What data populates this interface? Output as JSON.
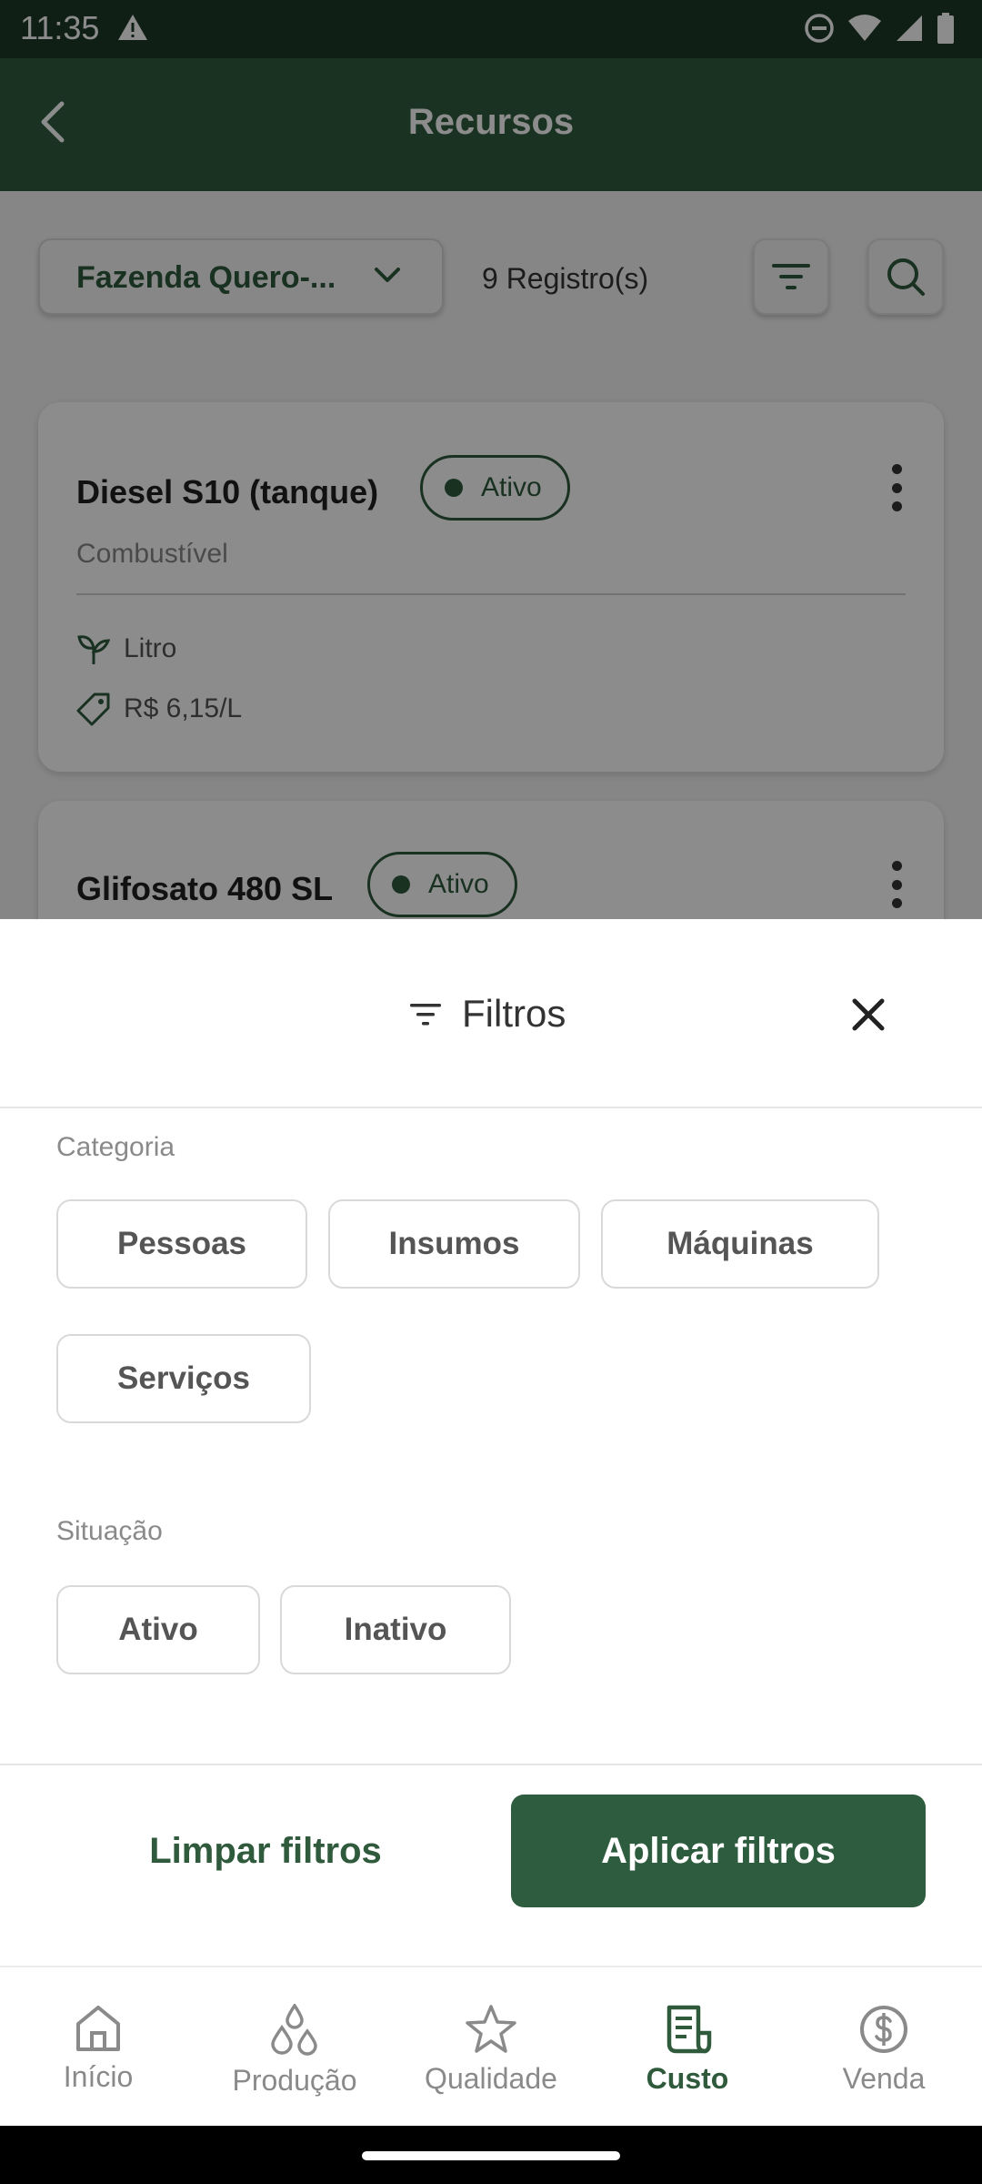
{
  "status_bar": {
    "time": "11:35"
  },
  "app_bar": {
    "title": "Recursos"
  },
  "toolbar": {
    "farm_selector": "Fazenda Quero-...",
    "record_count": "9 Registro(s)"
  },
  "cards": [
    {
      "title": "Diesel S10 (tanque)",
      "status": "Ativo",
      "category": "Combustível",
      "unit": "Litro",
      "price": "R$ 6,15/L"
    },
    {
      "title": "Glifosato 480 SL",
      "status": "Ativo"
    }
  ],
  "filters_sheet": {
    "title": "Filtros",
    "category_label": "Categoria",
    "categories": [
      "Pessoas",
      "Insumos",
      "Máquinas",
      "Serviços"
    ],
    "situation_label": "Situação",
    "situations": [
      "Ativo",
      "Inativo"
    ],
    "clear_label": "Limpar filtros",
    "apply_label": "Aplicar filtros"
  },
  "bottom_nav": [
    {
      "label": "Início",
      "icon": "home-icon"
    },
    {
      "label": "Produção",
      "icon": "drops-icon"
    },
    {
      "label": "Qualidade",
      "icon": "star-icon"
    },
    {
      "label": "Custo",
      "icon": "receipt-icon",
      "active": true
    },
    {
      "label": "Venda",
      "icon": "dollar-icon"
    }
  ],
  "colors": {
    "primary": "#2e5c3e",
    "status_bar": "#1e3a28",
    "muted": "#8a8a8a"
  }
}
